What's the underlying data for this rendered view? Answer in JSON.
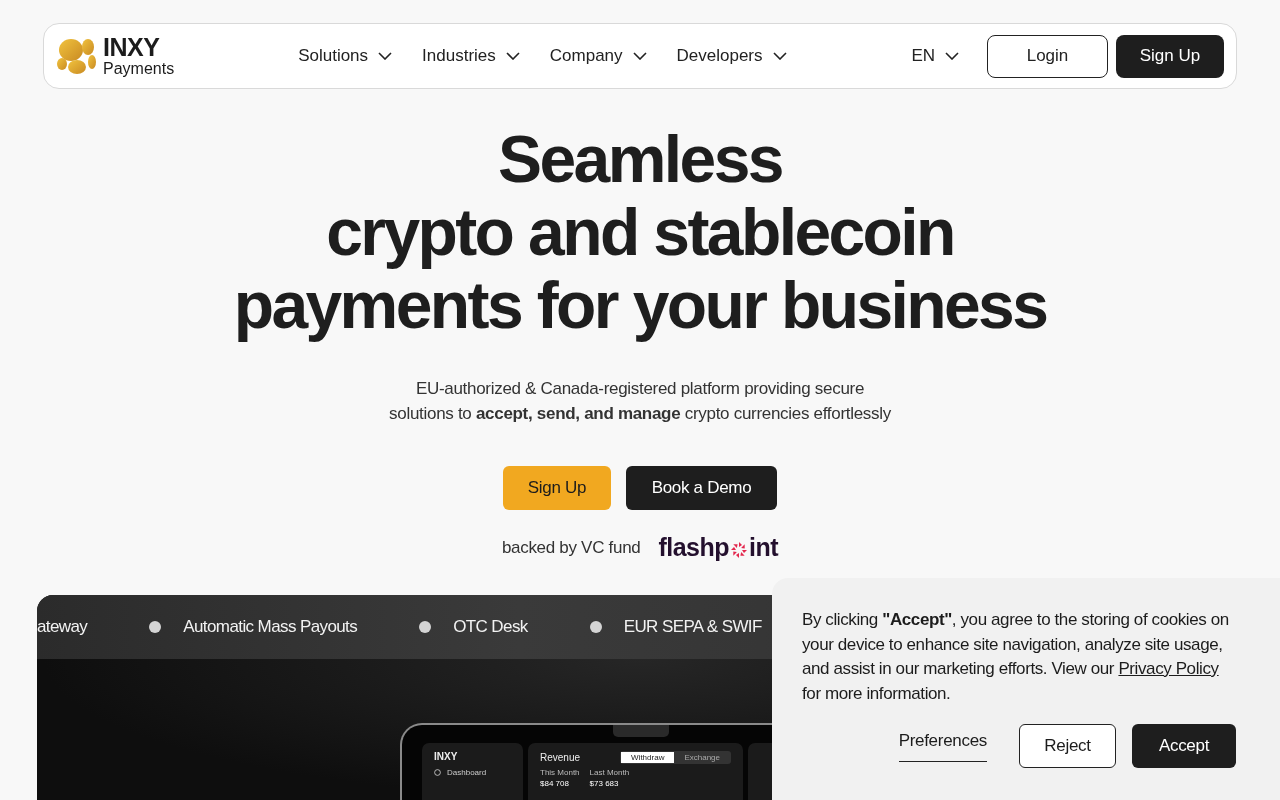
{
  "nav": {
    "logo": {
      "title": "INXY",
      "subtitle": "Payments"
    },
    "menu": [
      {
        "label": "Solutions"
      },
      {
        "label": "Industries"
      },
      {
        "label": "Company"
      },
      {
        "label": "Developers"
      }
    ],
    "language": "EN",
    "login": "Login",
    "signup": "Sign Up"
  },
  "hero": {
    "heading": [
      "Seamless",
      "crypto and stablecoin",
      "payments for your business"
    ],
    "subtitle": "EU-authorized & Canada-registered platform providing secure solutions to **accept, send, and manage** crypto currencies effortlessly",
    "buttons": [
      {
        "label": "Sign Up",
        "kind": "primary"
      },
      {
        "label": "Book a Demo",
        "kind": "dark"
      }
    ],
    "backed": "backed by VC fund",
    "fund_logo": {
      "before": "flashp",
      "after": "int"
    }
  },
  "showcase": {
    "ticker": [
      "ateway",
      "Automatic Mass Payouts",
      "OTC Desk",
      "EUR SEPA & SWIF"
    ],
    "dashboard": {
      "brand": "INXY",
      "nav_item": "Dashboard",
      "card_title": "Revenue",
      "toggle": [
        {
          "label": "Withdraw",
          "selected": true
        },
        {
          "label": "Exchange",
          "selected": false
        }
      ],
      "stats": [
        {
          "label": "This Month",
          "value": "$84 708"
        },
        {
          "label": "Last Month",
          "value": "$73 683"
        }
      ]
    }
  },
  "cookie": {
    "before": "By clicking **\"Accept\"**, you agree to the storing of cookies on your device to enhance site navigation, analyze site usage, and assist in our marketing efforts. View our ",
    "link": "Privacy Policy",
    "after": " for more information.",
    "buttons": [
      {
        "label": "Preferences",
        "kind": "link"
      },
      {
        "label": "Reject",
        "kind": "outline"
      },
      {
        "label": "Accept",
        "kind": "dark"
      }
    ]
  }
}
